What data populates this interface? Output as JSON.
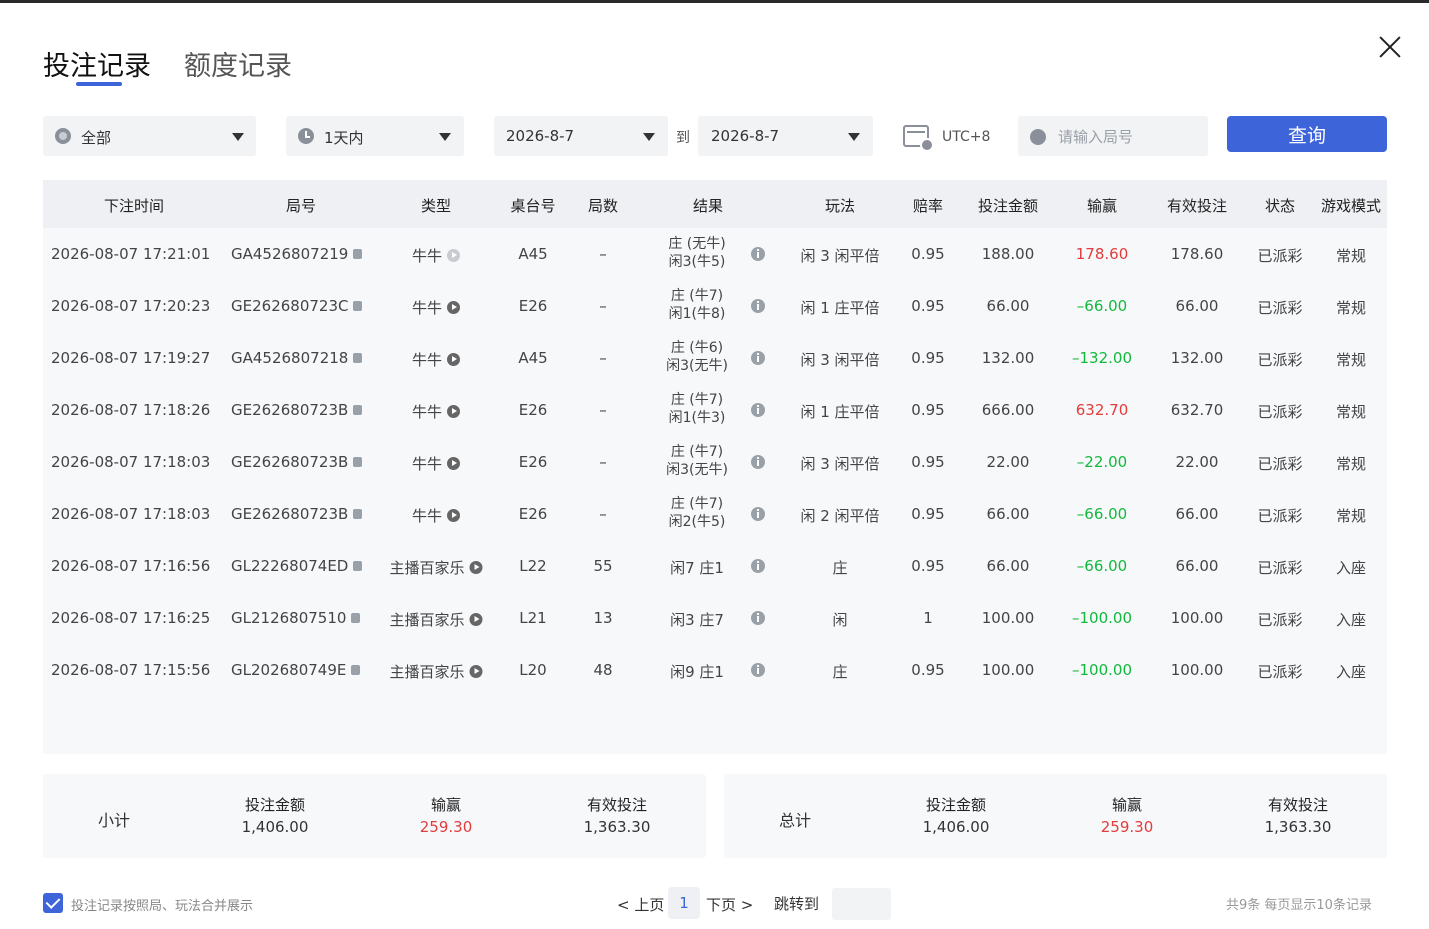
{
  "tabs": {
    "bets": "投注记录",
    "limits": "额度记录"
  },
  "filters": {
    "category": "全部",
    "range": "1天内",
    "date_from": "2026-8-7",
    "to_label": "到",
    "date_to": "2026-8-7",
    "timezone": "UTC+8",
    "search_placeholder": "请输入局号",
    "query_label": "查询"
  },
  "columns": [
    "下注时间",
    "局号",
    "类型",
    "桌台号",
    "局数",
    "结果",
    "玩法",
    "赔率",
    "投注金额",
    "输赢",
    "有效投注",
    "状态",
    "游戏模式"
  ],
  "rows": [
    {
      "time": "2026-08-07 17:21:01",
      "round": "GA4526807219",
      "type": "牛牛",
      "table": "A45",
      "count": "–",
      "result1": "庄 (无牛)",
      "result2": "闲3(牛5)",
      "play": "闲 3 闲平倍",
      "odds": "0.95",
      "bet": "188.00",
      "win": "178.60",
      "valid": "178.60",
      "status": "已派彩",
      "mode": "常规"
    },
    {
      "time": "2026-08-07 17:20:23",
      "round": "GE262680723C",
      "type": "牛牛",
      "table": "E26",
      "count": "–",
      "result1": "庄 (牛7)",
      "result2": "闲1(牛8)",
      "play": "闲 1 庄平倍",
      "odds": "0.95",
      "bet": "66.00",
      "win": "–66.00",
      "valid": "66.00",
      "status": "已派彩",
      "mode": "常规"
    },
    {
      "time": "2026-08-07 17:19:27",
      "round": "GA4526807218",
      "type": "牛牛",
      "table": "A45",
      "count": "–",
      "result1": "庄 (牛6)",
      "result2": "闲3(无牛)",
      "play": "闲 3 闲平倍",
      "odds": "0.95",
      "bet": "132.00",
      "win": "–132.00",
      "valid": "132.00",
      "status": "已派彩",
      "mode": "常规"
    },
    {
      "time": "2026-08-07 17:18:26",
      "round": "GE262680723B",
      "type": "牛牛",
      "table": "E26",
      "count": "–",
      "result1": "庄 (牛7)",
      "result2": "闲1(牛3)",
      "play": "闲 1 庄平倍",
      "odds": "0.95",
      "bet": "666.00",
      "win": "632.70",
      "valid": "632.70",
      "status": "已派彩",
      "mode": "常规"
    },
    {
      "time": "2026-08-07 17:18:03",
      "round": "GE262680723B",
      "type": "牛牛",
      "table": "E26",
      "count": "–",
      "result1": "庄 (牛7)",
      "result2": "闲3(无牛)",
      "play": "闲 3 闲平倍",
      "odds": "0.95",
      "bet": "22.00",
      "win": "–22.00",
      "valid": "22.00",
      "status": "已派彩",
      "mode": "常规"
    },
    {
      "time": "2026-08-07 17:18:03",
      "round": "GE262680723B",
      "type": "牛牛",
      "table": "E26",
      "count": "–",
      "result1": "庄 (牛7)",
      "result2": "闲2(牛5)",
      "play": "闲 2 闲平倍",
      "odds": "0.95",
      "bet": "66.00",
      "win": "–66.00",
      "valid": "66.00",
      "status": "已派彩",
      "mode": "常规"
    },
    {
      "time": "2026-08-07 17:16:56",
      "round": "GL22268074ED",
      "type": "主播百家乐",
      "table": "L22",
      "count": "55",
      "result1": "闲7 庄1",
      "result2": "",
      "play": "庄",
      "odds": "0.95",
      "bet": "66.00",
      "win": "–66.00",
      "valid": "66.00",
      "status": "已派彩",
      "mode": "入座"
    },
    {
      "time": "2026-08-07 17:16:25",
      "round": "GL2126807510",
      "type": "主播百家乐",
      "table": "L21",
      "count": "13",
      "result1": "闲3 庄7",
      "result2": "",
      "play": "闲",
      "odds": "1",
      "bet": "100.00",
      "win": "–100.00",
      "valid": "100.00",
      "status": "已派彩",
      "mode": "入座"
    },
    {
      "time": "2026-08-07 17:15:56",
      "round": "GL202680749E",
      "type": "主播百家乐",
      "table": "L20",
      "count": "48",
      "result1": "闲9 庄1",
      "result2": "",
      "play": "庄",
      "odds": "0.95",
      "bet": "100.00",
      "win": "–100.00",
      "valid": "100.00",
      "status": "已派彩",
      "mode": "入座"
    }
  ],
  "subtotal": {
    "label": "小计",
    "bet_label": "投注金额",
    "bet": "1,406.00",
    "win_label": "输赢",
    "win": "259.30",
    "valid_label": "有效投注",
    "valid": "1,363.30"
  },
  "total": {
    "label": "总计",
    "bet_label": "投注金额",
    "bet": "1,406.00",
    "win_label": "输赢",
    "win": "259.30",
    "valid_label": "有效投注",
    "valid": "1,363.30"
  },
  "footer": {
    "merge_label": "投注记录按照局、玩法合并展示",
    "prev": "< 上页",
    "page": "1",
    "next": "下页 >",
    "jump": "跳转到",
    "stats": "共9条   每页显示10条记录"
  },
  "colors": {
    "accent": "#3e64d9",
    "negative": "#12b83e",
    "positive": "#e23c3c"
  }
}
